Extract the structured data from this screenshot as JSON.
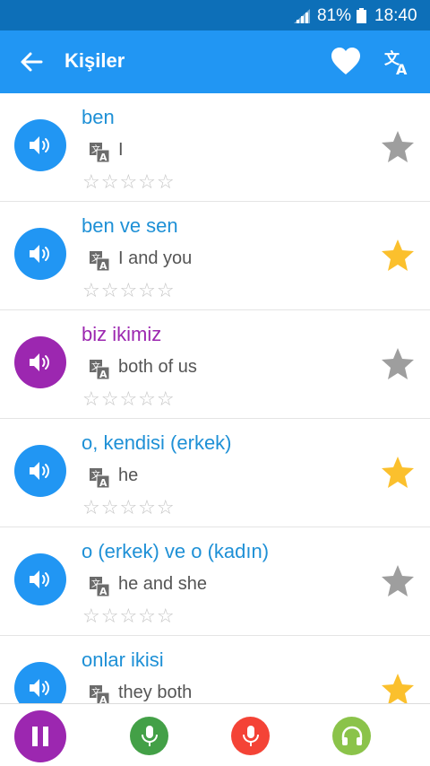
{
  "status_bar": {
    "battery": "81%",
    "time": "18:40"
  },
  "app_bar": {
    "title": "Kişiler"
  },
  "colors": {
    "status_bar": "#0d6fb8",
    "app_bar": "#2196f3",
    "speaker_default": "#2196f3",
    "speaker_highlight": "#9c27b0",
    "phrase_default": "#1e90d6",
    "phrase_highlight": "#9c27b0",
    "star_active": "#fbc02d",
    "star_inactive": "#9e9e9e"
  },
  "phrases": [
    {
      "text": "ben",
      "translation": "I",
      "favorite": false,
      "highlighted": false,
      "rating": "☆☆☆☆☆"
    },
    {
      "text": "ben ve sen",
      "translation": "I and you",
      "favorite": true,
      "highlighted": false,
      "rating": "☆☆☆☆☆"
    },
    {
      "text": "biz ikimiz",
      "translation": "both of us",
      "favorite": false,
      "highlighted": true,
      "rating": "☆☆☆☆☆"
    },
    {
      "text": "o, kendisi (erkek)",
      "translation": "he",
      "favorite": true,
      "highlighted": false,
      "rating": "☆☆☆☆☆"
    },
    {
      "text": "o (erkek) ve o (kadın)",
      "translation": "he and she",
      "favorite": false,
      "highlighted": false,
      "rating": "☆☆☆☆☆"
    },
    {
      "text": "onlar ikisi",
      "translation": "they both",
      "favorite": true,
      "highlighted": false,
      "rating": "☆☆☆☆☆"
    }
  ],
  "bottom_bar": {
    "buttons": [
      {
        "name": "pause-button",
        "icon": "pause-icon",
        "color": "#9c27b0"
      },
      {
        "name": "microphone-button",
        "icon": "microphone-icon",
        "color": "#43a047"
      },
      {
        "name": "record-button",
        "icon": "microphone-icon",
        "color": "#f44336"
      },
      {
        "name": "listen-button",
        "icon": "headphones-icon",
        "color": "#8bc34a"
      }
    ]
  }
}
